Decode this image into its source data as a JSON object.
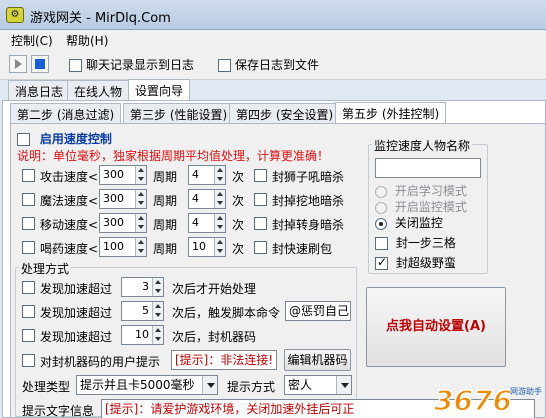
{
  "window": {
    "title": "游戏网关 - MirDlq.Com",
    "icon": "app-icon"
  },
  "menu": [
    {
      "label": "控制(C)"
    },
    {
      "label": "帮助(H)"
    }
  ],
  "toolbar": {
    "play_icon": "play-icon",
    "stop_icon": "stop-icon",
    "chat_log": {
      "label": "聊天记录显示到日志",
      "checked": false
    },
    "save_log": {
      "label": "保存日志到文件",
      "checked": false
    }
  },
  "main_tabs": [
    {
      "label": "消息日志"
    },
    {
      "label": "在线人物"
    },
    {
      "label": "设置向导"
    }
  ],
  "sub_tabs": [
    {
      "label": "第二步 (消息过滤)"
    },
    {
      "label": "第三步 (性能设置)"
    },
    {
      "label": "第四步 (安全设置)"
    },
    {
      "label": "第五步 (外挂控制)"
    }
  ],
  "speed": {
    "enable_label": "启用速度控制",
    "note": "说明：单位毫秒，独家根据周期平均值处理，计算更准确！",
    "rows": [
      {
        "label": "攻击速度<",
        "value": "300",
        "period_label": "周期",
        "period": "4",
        "unit": "次",
        "lock_label": "封狮子吼暗杀"
      },
      {
        "label": "魔法速度<",
        "value": "300",
        "period_label": "周期",
        "period": "4",
        "unit": "次",
        "lock_label": "封掉挖地暗杀"
      },
      {
        "label": "移动速度<",
        "value": "300",
        "period_label": "周期",
        "period": "4",
        "unit": "次",
        "lock_label": "封掉转身暗杀"
      },
      {
        "label": "喝药速度<",
        "value": "100",
        "period_label": "周期",
        "period": "10",
        "unit": "次",
        "lock_label": "封快速刷包"
      }
    ]
  },
  "monitor": {
    "title": "监控速度人物名称",
    "name_value": "",
    "options": [
      {
        "label": "开启学习模式",
        "checked": false,
        "disabled": true
      },
      {
        "label": "开启监控模式",
        "checked": false,
        "disabled": true
      },
      {
        "label": "关闭监控",
        "checked": true,
        "disabled": false
      }
    ],
    "checks": [
      {
        "label": "封一步三格",
        "checked": false
      },
      {
        "label": "封超级野蛮",
        "checked": true
      }
    ]
  },
  "handling": {
    "title": "处理方式",
    "rows": [
      {
        "prefix": "发现加速超过",
        "value": "3",
        "suffix": "次后才开始处理"
      },
      {
        "prefix": "发现加速超过",
        "value": "5",
        "suffix": "次后，触发脚本命令",
        "command": "@惩罚自己"
      },
      {
        "prefix": "发现加速超过",
        "value": "10",
        "suffix": "次后，封机器码"
      }
    ],
    "machine_prompt_label": "对封机器码的用户提示",
    "machine_prompt_value": "[提示]：非法连接!",
    "edit_machine_button": "编辑机器码",
    "type_label": "处理类型",
    "type_value": "提示并且卡5000毫秒",
    "prompt_mode_label": "提示方式",
    "prompt_mode_value": "密人",
    "prompt_text_label": "提示文字信息",
    "prompt_text_value": "[提示]：请爱护游戏环境，关闭加速外挂后可正",
    "auto_button": "点我自动设置(A)"
  },
  "watermark": {
    "text": "3676",
    "subtext": "网游助手",
    "color": "#f08a00"
  }
}
